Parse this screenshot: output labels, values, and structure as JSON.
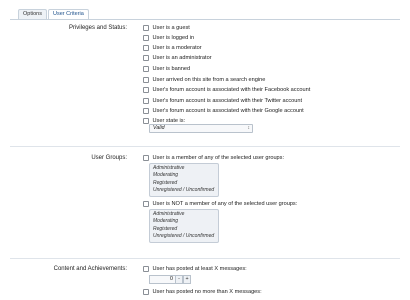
{
  "tabs": [
    "Options",
    "User Criteria"
  ],
  "sections": {
    "privileges": {
      "label": "Privileges and Status:",
      "items": [
        "User is a guest",
        "User is logged in",
        "User is a moderator",
        "User is an administrator",
        "User is banned",
        "User arrived on this site from a search engine",
        "User's forum account is associated with their Facebook account",
        "User's forum account is associated with their Twitter account",
        "User's forum account is associated with their Google account",
        "User state is:"
      ],
      "state_value": "Valid"
    },
    "groups": {
      "label": "User Groups:",
      "member_label": "User is a member of any of the selected user groups:",
      "not_member_label": "User is NOT a member of any of the selected user groups:",
      "group_options": [
        "Administrative",
        "Moderating",
        "Registered",
        "Unregistered / Unconfirmed"
      ]
    },
    "content": {
      "label": "Content and Achievements:",
      "posted_at_least": "User has posted at least X messages:",
      "posted_at_least_value": "0",
      "posted_no_more": "User has posted no more than X messages:"
    }
  },
  "stepper": {
    "minus": "-",
    "plus": "+"
  }
}
